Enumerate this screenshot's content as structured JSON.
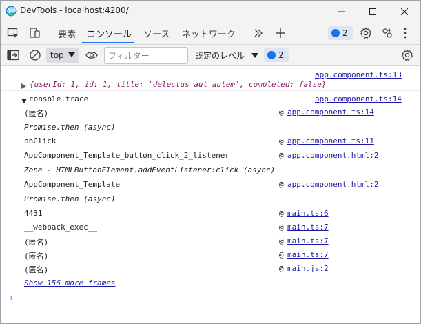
{
  "window": {
    "title": "DevTools - localhost:4200/"
  },
  "toolbar": {
    "tabs": [
      {
        "label": "要素"
      },
      {
        "label": "コンソール"
      },
      {
        "label": "ソース"
      },
      {
        "label": "ネットワーク"
      }
    ],
    "active_tab": "コンソール",
    "issues_count": "2"
  },
  "console_toolbar": {
    "context": "top",
    "filter_placeholder": "フィルター",
    "levels_label": "既定のレベル",
    "issues_count": "2"
  },
  "console": {
    "log_source": "app.component.ts:13",
    "log_object": "{userId: 1, id: 1, title: 'delectus aut autem', completed: false}",
    "trace_label": "console.trace",
    "trace_source": "app.component.ts:14",
    "frames": [
      {
        "fn": "(匿名)",
        "at": "@",
        "src": "app.component.ts:14",
        "italic": false
      },
      {
        "fn": "Promise.then (async)",
        "at": "",
        "src": "",
        "italic": true
      },
      {
        "fn": "onClick",
        "at": "@",
        "src": "app.component.ts:11",
        "italic": false
      },
      {
        "fn": "AppComponent_Template_button_click_2_listener",
        "at": "@",
        "src": "app.component.html:2",
        "italic": false
      },
      {
        "fn": "Zone - HTMLButtonElement.addEventListener:click (async)",
        "at": "",
        "src": "",
        "italic": true
      },
      {
        "fn": "AppComponent_Template",
        "at": "@",
        "src": "app.component.html:2",
        "italic": false
      },
      {
        "fn": "Promise.then (async)",
        "at": "",
        "src": "",
        "italic": true
      },
      {
        "fn": "4431",
        "at": "@",
        "src": "main.ts:6",
        "italic": false
      },
      {
        "fn": "__webpack_exec__",
        "at": "@",
        "src": "main.ts:7",
        "italic": false
      },
      {
        "fn": "(匿名)",
        "at": "@",
        "src": "main.ts:7",
        "italic": false
      },
      {
        "fn": "(匿名)",
        "at": "@",
        "src": "main.ts:7",
        "italic": false
      },
      {
        "fn": "(匿名)",
        "at": "@",
        "src": "main.js:2",
        "italic": false
      }
    ],
    "show_more": "Show 156 more frames",
    "prompt": "›"
  },
  "colors": {
    "accent": "#1a73e8",
    "link": "#1a1aa6",
    "object_text": "#8b1a6a",
    "chrome_bg": "#f3f3f3"
  }
}
